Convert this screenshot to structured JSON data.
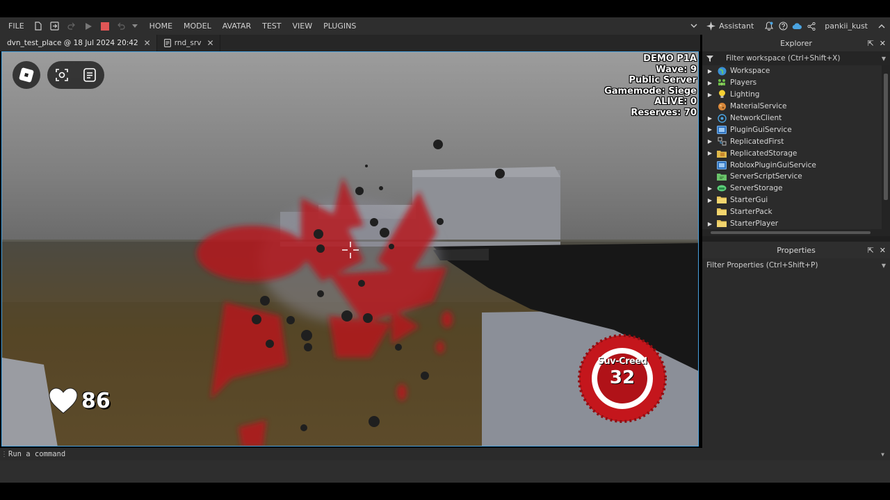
{
  "menubar": {
    "file": "FILE",
    "tabs": [
      "HOME",
      "MODEL",
      "AVATAR",
      "TEST",
      "VIEW",
      "PLUGINS"
    ],
    "assistant": "Assistant",
    "username": "pankii_kust"
  },
  "doc_tabs": [
    {
      "label": "dvn_test_place @ 18 Jul 2024 20:42",
      "active": true
    },
    {
      "label": "rnd_srv",
      "active": false
    }
  ],
  "game_hud": {
    "stats": [
      "DEMO P1A",
      "Wave: 9",
      "Public Server",
      "Gamemode: Siege",
      "ALIVE: 0",
      "Reserves: 70"
    ],
    "health": "86",
    "creed_label": "Suv-Creed",
    "creed_count": "32"
  },
  "explorer": {
    "title": "Explorer",
    "filter_placeholder": "Filter workspace (Ctrl+Shift+X)",
    "items": [
      {
        "label": "Workspace",
        "expandable": true,
        "icon": "globe-icon"
      },
      {
        "label": "Players",
        "expandable": true,
        "icon": "players-icon"
      },
      {
        "label": "Lighting",
        "expandable": true,
        "icon": "lightbulb-icon"
      },
      {
        "label": "MaterialService",
        "expandable": false,
        "icon": "material-icon"
      },
      {
        "label": "NetworkClient",
        "expandable": true,
        "icon": "network-icon"
      },
      {
        "label": "PluginGuiService",
        "expandable": true,
        "icon": "plugin-gui-icon"
      },
      {
        "label": "ReplicatedFirst",
        "expandable": true,
        "icon": "replicated-first-icon"
      },
      {
        "label": "ReplicatedStorage",
        "expandable": true,
        "icon": "replicated-storage-icon"
      },
      {
        "label": "RobloxPluginGuiService",
        "expandable": false,
        "icon": "plugin-gui-icon"
      },
      {
        "label": "ServerScriptService",
        "expandable": false,
        "icon": "server-script-icon"
      },
      {
        "label": "ServerStorage",
        "expandable": true,
        "icon": "server-storage-icon"
      },
      {
        "label": "StarterGui",
        "expandable": true,
        "icon": "folder-icon"
      },
      {
        "label": "StarterPack",
        "expandable": false,
        "icon": "folder-icon"
      },
      {
        "label": "StarterPlayer",
        "expandable": true,
        "icon": "folder-icon"
      }
    ]
  },
  "properties": {
    "title": "Properties",
    "filter_placeholder": "Filter Properties (Ctrl+Shift+P)"
  },
  "command_bar": {
    "placeholder": "Run a command"
  },
  "colors": {
    "accent": "#4aa3e0",
    "stop": "#e05656",
    "creed_red": "#c4161c"
  }
}
